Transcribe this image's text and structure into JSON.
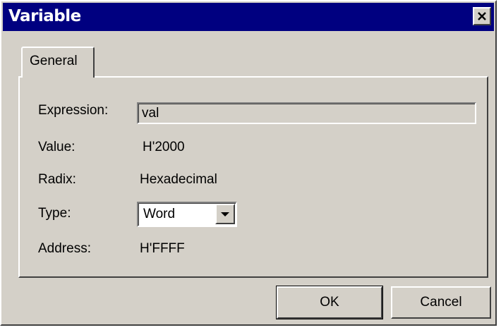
{
  "window": {
    "title": "Variable",
    "close_icon": "close-icon"
  },
  "tabs": [
    {
      "label": "General",
      "active": true
    }
  ],
  "fields": {
    "expression": {
      "label": "Expression:",
      "value": "val"
    },
    "value": {
      "label": "Value:",
      "value": "H'2000"
    },
    "radix": {
      "label": "Radix:",
      "value": "Hexadecimal"
    },
    "type": {
      "label": "Type:",
      "selected": "Word",
      "dropdown_icon": "chevron-down-icon"
    },
    "address": {
      "label": "Address:",
      "value": "H'FFFF"
    }
  },
  "buttons": {
    "ok_label": "OK",
    "cancel_label": "Cancel"
  },
  "colors": {
    "titlebar": "#000080",
    "face": "#d4d0c8"
  }
}
